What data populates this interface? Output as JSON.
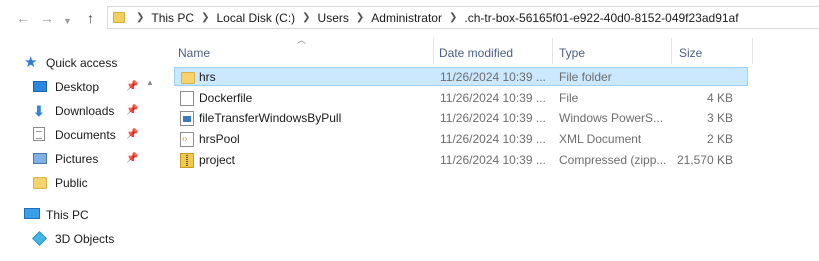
{
  "address_bar": {
    "crumbs": [
      "This PC",
      "Local Disk (C:)",
      "Users",
      "Administrator",
      ".ch-tr-box-56165f01-e922-40d0-8152-049f23ad91af"
    ]
  },
  "nav_pane": {
    "items": [
      {
        "label": "Quick access",
        "icon": "star-icon"
      },
      {
        "label": "Desktop",
        "icon": "desktop-icon",
        "pinned": true
      },
      {
        "label": "Downloads",
        "icon": "download-icon",
        "pinned": true
      },
      {
        "label": "Documents",
        "icon": "documents-icon",
        "pinned": true
      },
      {
        "label": "Pictures",
        "icon": "pictures-icon",
        "pinned": true
      },
      {
        "label": "Public",
        "icon": "folder-icon"
      },
      {
        "label": "This PC",
        "icon": "computer-icon"
      },
      {
        "label": "3D Objects",
        "icon": "3d-objects-icon"
      }
    ]
  },
  "columns": {
    "name": "Name",
    "date": "Date modified",
    "type": "Type",
    "size": "Size"
  },
  "files": [
    {
      "name": "hrs",
      "date": "11/26/2024 10:39 ...",
      "type": "File folder",
      "size": "",
      "icon": "folder-icon",
      "selected": true
    },
    {
      "name": "Dockerfile",
      "date": "11/26/2024 10:39 ...",
      "type": "File",
      "size": "4 KB",
      "icon": "file-icon"
    },
    {
      "name": "fileTransferWindowsByPull",
      "date": "11/26/2024 10:39 ...",
      "type": "Windows PowerS...",
      "size": "3 KB",
      "icon": "powershell-script-icon"
    },
    {
      "name": "hrsPool",
      "date": "11/26/2024 10:39 ...",
      "type": "XML Document",
      "size": "2 KB",
      "icon": "xml-document-icon"
    },
    {
      "name": "project",
      "date": "11/26/2024 10:39 ...",
      "type": "Compressed (zipp...",
      "size": "21,570 KB",
      "icon": "zip-archive-icon"
    }
  ],
  "colors": {
    "selection_bg": "#cce8ff",
    "selection_border": "#99d1ff",
    "header_text": "#4d6082"
  }
}
